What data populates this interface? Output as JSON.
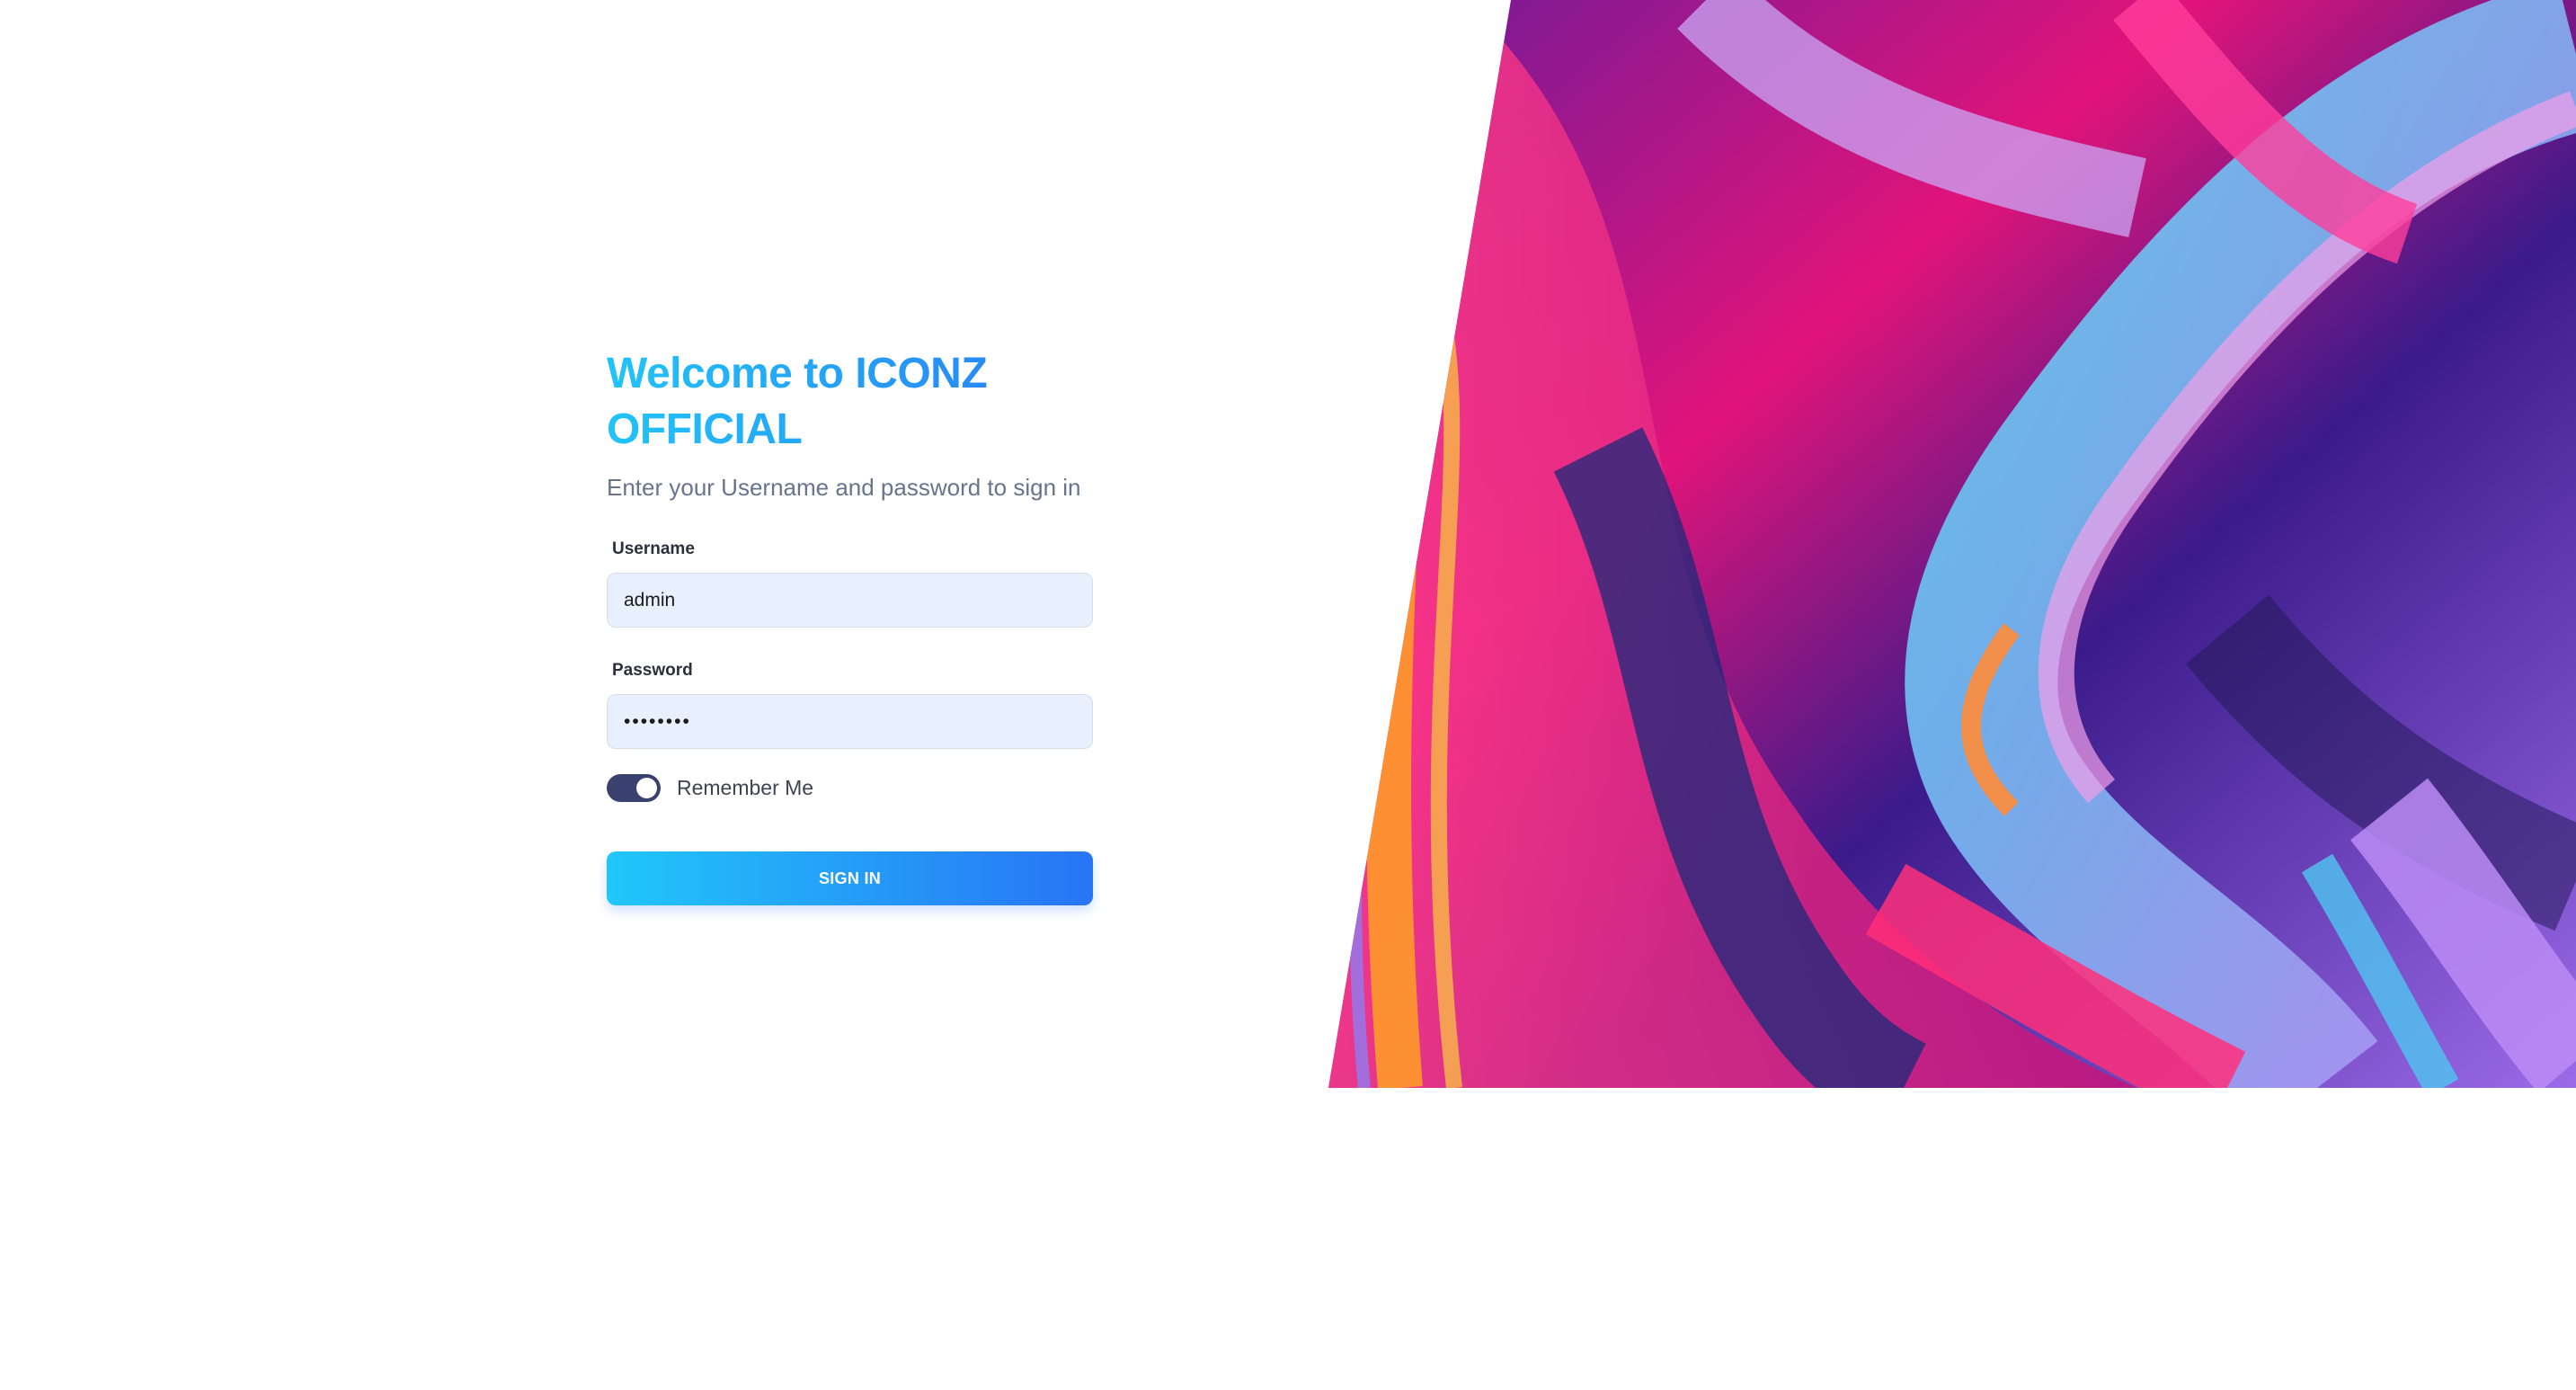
{
  "login": {
    "title": "Welcome to ICONZ OFFICIAL",
    "subtitle": "Enter your Username and password to sign in",
    "username_label": "Username",
    "username_value": "admin",
    "password_label": "Password",
    "password_value": "••••••••",
    "remember_label": "Remember Me",
    "remember_enabled": true,
    "signin_label": "SIGN IN"
  },
  "colors": {
    "title_gradient_start": "#21c4f8",
    "title_gradient_end": "#2a7bf5",
    "toggle_on": "#3a416f",
    "input_background": "#e8f0fd",
    "button_gradient_start": "#21c7fa",
    "button_gradient_end": "#2874f5"
  },
  "artwork": {
    "name": "abstract-colorful-wave-image"
  }
}
